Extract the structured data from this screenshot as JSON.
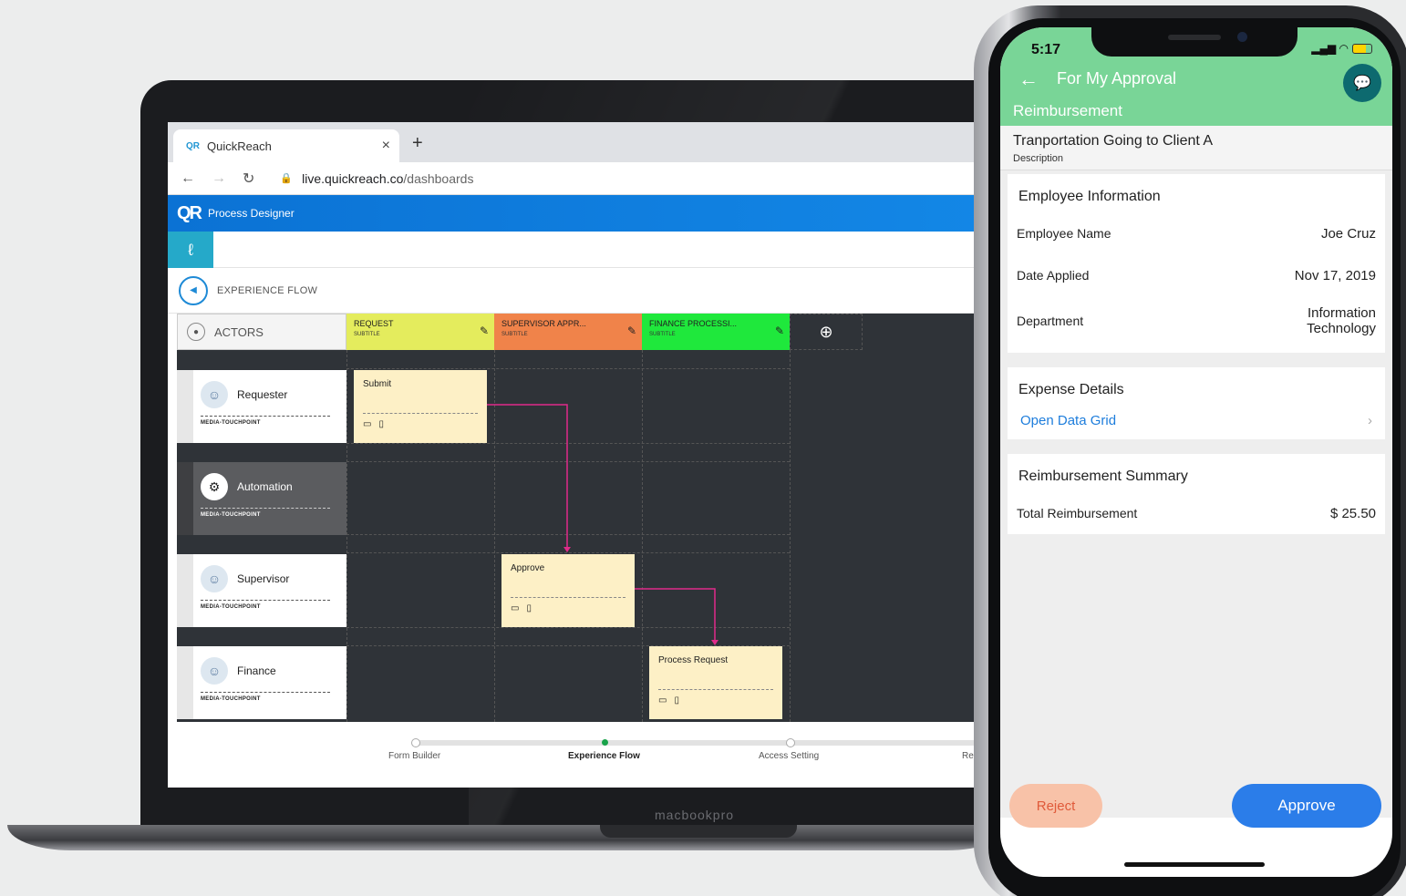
{
  "laptop": {
    "brand_label": "macbookpro",
    "browser": {
      "tab_title": "QuickReach",
      "tab_favicon": "QR",
      "url_host": "live.quickreach.co",
      "url_path": "/dashboards"
    },
    "app": {
      "logo": "QR",
      "title": "Process Designer",
      "flow_title": "EXPERIENCE FLOW"
    },
    "board": {
      "actors_header": "ACTORS",
      "columns": [
        {
          "title": "REQUEST",
          "subtitle": "SUBTITLE",
          "color": "#e4ec5d"
        },
        {
          "title": "SUPERVISOR APPR...",
          "subtitle": "SUBTITLE",
          "color": "#f0834a"
        },
        {
          "title": "FINANCE PROCESSI...",
          "subtitle": "SUBTITLE",
          "color": "#1fe83c"
        }
      ],
      "actors": [
        {
          "name": "Requester",
          "touchpoint": "MEDIA-TOUCHPOINT"
        },
        {
          "name": "Automation",
          "touchpoint": "MEDIA-TOUCHPOINT"
        },
        {
          "name": "Supervisor",
          "touchpoint": "MEDIA-TOUCHPOINT"
        },
        {
          "name": "Finance",
          "touchpoint": "MEDIA-TOUCHPOINT"
        }
      ],
      "steps": [
        {
          "label": "Submit"
        },
        {
          "label": "Approve"
        },
        {
          "label": "Process Request"
        }
      ],
      "connector_color": "#e02b8a"
    },
    "progress": {
      "steps": [
        "Form Builder",
        "Experience Flow",
        "Access Setting",
        "Re"
      ],
      "active": "Experience Flow"
    }
  },
  "phone": {
    "time": "5:17",
    "header_title": "For My Approval",
    "header_subtitle": "Reimbursement",
    "description_value": "Tranportation Going to Client A",
    "description_label": "Description",
    "employee_section": {
      "title": "Employee Information",
      "rows": [
        {
          "label": "Employee Name",
          "value": "Joe Cruz"
        },
        {
          "label": "Date Applied",
          "value": "Nov 17, 2019"
        },
        {
          "label": "Department",
          "value": "Information Technology"
        }
      ]
    },
    "expense_section": {
      "title": "Expense Details",
      "link": "Open Data Grid"
    },
    "summary_section": {
      "title": "Reimbursement Summary",
      "rows": [
        {
          "label": "Total Reimbursement",
          "value": "$ 25.50"
        }
      ]
    },
    "reject_label": "Reject",
    "approve_label": "Approve",
    "header_color": "#79d597"
  }
}
